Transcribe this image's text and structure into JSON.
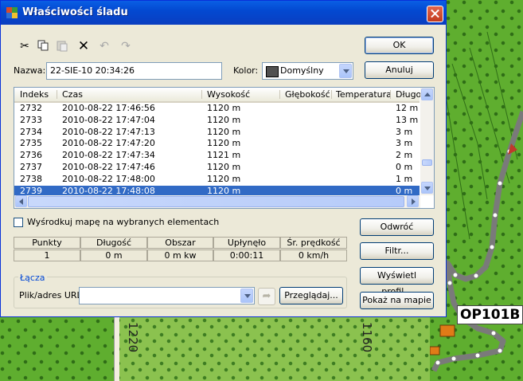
{
  "map": {
    "contour_labels": [
      "1220",
      "1160"
    ],
    "waypoint_label": "OP101B"
  },
  "dialog": {
    "title": "Właściwości śladu",
    "buttons": {
      "ok": "OK",
      "cancel": "Anuluj",
      "reverse": "Odwróć",
      "filter": "Filtr...",
      "show_profile": "Wyświetl profil...",
      "show_on_map": "Pokaż na mapie",
      "browse": "Przeglądaj..."
    },
    "name_label": "Nazwa:",
    "name_value": "22-SIE-10 20:34:26",
    "color_label": "Kolor:",
    "color_value": "Domyślny",
    "color_swatch": "#505050",
    "table": {
      "columns": [
        "Indeks",
        "Czas",
        "Wysokość",
        "Głębokość",
        "Temperatura",
        "Długo"
      ],
      "rows": [
        [
          "2732",
          "2010-08-22 17:46:56",
          "1120 m",
          "",
          "",
          "12 m"
        ],
        [
          "2733",
          "2010-08-22 17:47:04",
          "1120 m",
          "",
          "",
          "13 m"
        ],
        [
          "2734",
          "2010-08-22 17:47:13",
          "1120 m",
          "",
          "",
          "3 m"
        ],
        [
          "2735",
          "2010-08-22 17:47:20",
          "1120 m",
          "",
          "",
          "3 m"
        ],
        [
          "2736",
          "2010-08-22 17:47:34",
          "1121 m",
          "",
          "",
          "2 m"
        ],
        [
          "2737",
          "2010-08-22 17:47:46",
          "1120 m",
          "",
          "",
          "0 m"
        ],
        [
          "2738",
          "2010-08-22 17:48:00",
          "1120 m",
          "",
          "",
          "1 m"
        ],
        [
          "2739",
          "2010-08-22 17:48:08",
          "1120 m",
          "",
          "",
          "0 m"
        ]
      ],
      "selected_row": 7
    },
    "center_map_label": "Wyśrodkuj mapę na wybranych elementach",
    "stats": {
      "headers": [
        "Punkty",
        "Długość",
        "Obszar",
        "Upłynęło czasu",
        "Śr. prędkość"
      ],
      "values": [
        "1",
        "0 m",
        "0 m kw",
        "0:00:11",
        "0 km/h"
      ]
    },
    "links_group": "Łącza",
    "url_label": "Plik/adres URL:",
    "url_value": ""
  }
}
